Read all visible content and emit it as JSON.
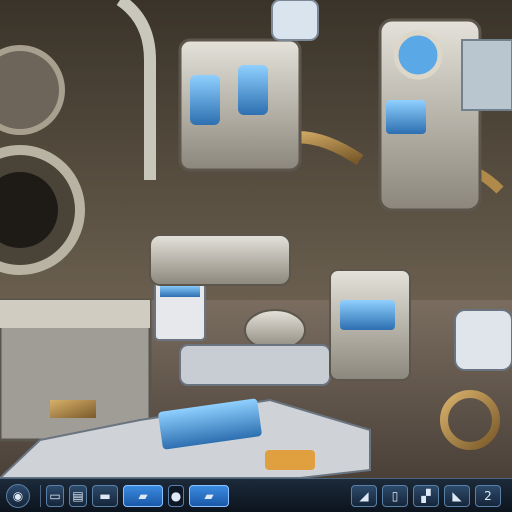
{
  "image": {
    "description_colors": {
      "sky_dark": "#2a2620",
      "metal_light": "#c9c6bb",
      "metal_mid": "#8a8478",
      "brass": "#b08a4a",
      "screen_blue": "#5aa8e6",
      "floor": "#7a6d60",
      "panel_dark": "#3d3a34"
    }
  },
  "taskbar": {
    "icons": [
      {
        "name": "globe-icon",
        "glyph": "◉"
      },
      {
        "name": "window-icon",
        "glyph": "▭"
      },
      {
        "name": "stack-icon",
        "glyph": "▤"
      },
      {
        "name": "dock-icon",
        "glyph": "▬"
      },
      {
        "name": "active-app-icon",
        "glyph": "▰"
      },
      {
        "name": "circle-icon",
        "glyph": "●"
      },
      {
        "name": "app-icon",
        "glyph": "▰"
      },
      {
        "name": "arrow-icon",
        "glyph": "◢"
      },
      {
        "name": "file-icon",
        "glyph": "▯"
      },
      {
        "name": "chart-icon",
        "glyph": "▞"
      },
      {
        "name": "tray-icon",
        "glyph": "◣"
      },
      {
        "name": "number-icon",
        "glyph": "2"
      }
    ]
  }
}
